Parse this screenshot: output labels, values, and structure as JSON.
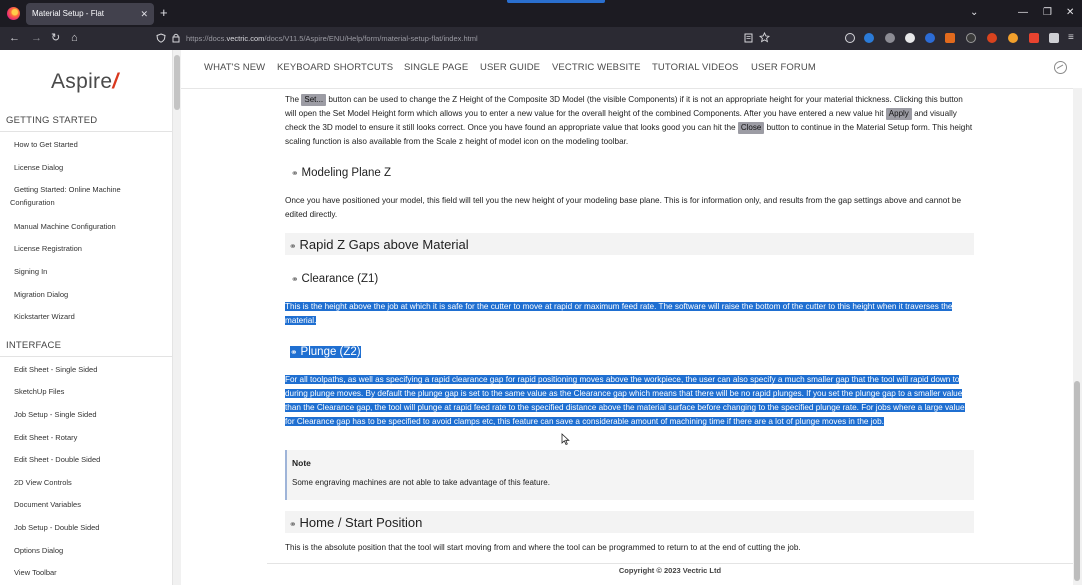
{
  "browser": {
    "tab_title": "Material Setup - Flat",
    "tab_close": "✕",
    "new_tab": "+",
    "url_prefix": "https://docs.",
    "url_domain": "vectric.com",
    "url_rest": "/docs/V11.5/Aspire/ENU/Help/form/material-setup-flat/index.html",
    "window_controls": [
      "⌄",
      "—",
      "❐",
      "✕"
    ],
    "nav_buttons": [
      "←",
      "→",
      "↻",
      "⌂"
    ]
  },
  "sidebar": {
    "brand": "Aspire",
    "brand_mark": "/",
    "sections": [
      {
        "title": "GETTING STARTED",
        "items": [
          "How to Get Started",
          "License Dialog",
          "Getting Started: Online Machine Configuration",
          "Manual Machine Configuration",
          "License Registration",
          "Signing In",
          "Migration Dialog",
          "Kickstarter Wizard"
        ]
      },
      {
        "title": "INTERFACE",
        "items": [
          "Edit Sheet - Single Sided",
          "SketchUp Files",
          "Job Setup - Single Sided",
          "Edit Sheet - Rotary",
          "Edit Sheet - Double Sided",
          "2D View Controls",
          "Document Variables",
          "Job Setup - Double Sided",
          "Options Dialog",
          "View Toolbar"
        ]
      }
    ]
  },
  "topnav": [
    "WHAT'S NEW",
    "KEYBOARD SHORTCUTS",
    "SINGLE PAGE",
    "USER GUIDE",
    "VECTRIC WEBSITE",
    "TUTORIAL VIDEOS",
    "USER FORUM"
  ],
  "content": {
    "p1_a": "The",
    "p1_set": "Set...",
    "p1_b": "button can be used to change the Z Height of the Composite 3D Model (the visible Components) if it is not an appropriate height for your material thickness. Clicking this button will open the Set Model Height form which allows you to enter a new value for the overall height of the combined Components. After you have entered a new value hit",
    "p1_apply": "Apply",
    "p1_c": "and visually check the 3D model to ensure it still looks correct. Once you have found an appropriate value that looks good you can hit the",
    "p1_close": "Close",
    "p1_d": "button to continue in the Material Setup form. This height scaling function is also available from the Scale z height of model icon on the modeling toolbar.",
    "h_modeling": "Modeling Plane Z",
    "p_modeling": "Once you have positioned your model, this field will tell you the new height of your modeling base plane. This is for information only, and results from the gap settings above and cannot be edited directly.",
    "h_rapid": "Rapid Z Gaps above Material",
    "h_clearance": "Clearance (Z1)",
    "p_clearance": "This is the height above the job at which it is safe for the cutter to move at rapid or maximum feed rate. The software will raise the bottom of the cutter to this height when it traverses the material.",
    "h_plunge": "Plunge (Z2)",
    "p_plunge": "For all toolpaths, as well as specifying a rapid clearance gap for rapid positioning moves above the workpiece, the user can also specify a much smaller gap that the tool will rapid down to during plunge moves. By default the plunge gap is set to the same value as the Clearance gap which means that there will be no rapid plunges. If you set the plunge gap to a smaller value than the Clearance gap, the tool will plunge at rapid feed rate to the specified distance above the material surface before changing to the specified plunge rate. For jobs where a large value for Clearance gap has to be specified to avoid clamps etc, this feature can save a considerable amount of machining time if there are a lot of plunge moves in the job.",
    "note_title": "Note",
    "note_body": "Some engraving machines are not able to take advantage of this feature.",
    "h_home": "Home / Start Position",
    "p_home": "This is the absolute position that the tool will start moving from and where the tool can be programmed to return to at the end of cutting the job.",
    "footer": "Copyright © 2023 Vectric Ltd"
  },
  "colors": {
    "selection": "#1f6fd1",
    "brand_accent": "#d9381e",
    "tabbar": "#1c1b22",
    "navbar": "#2b2a33"
  }
}
